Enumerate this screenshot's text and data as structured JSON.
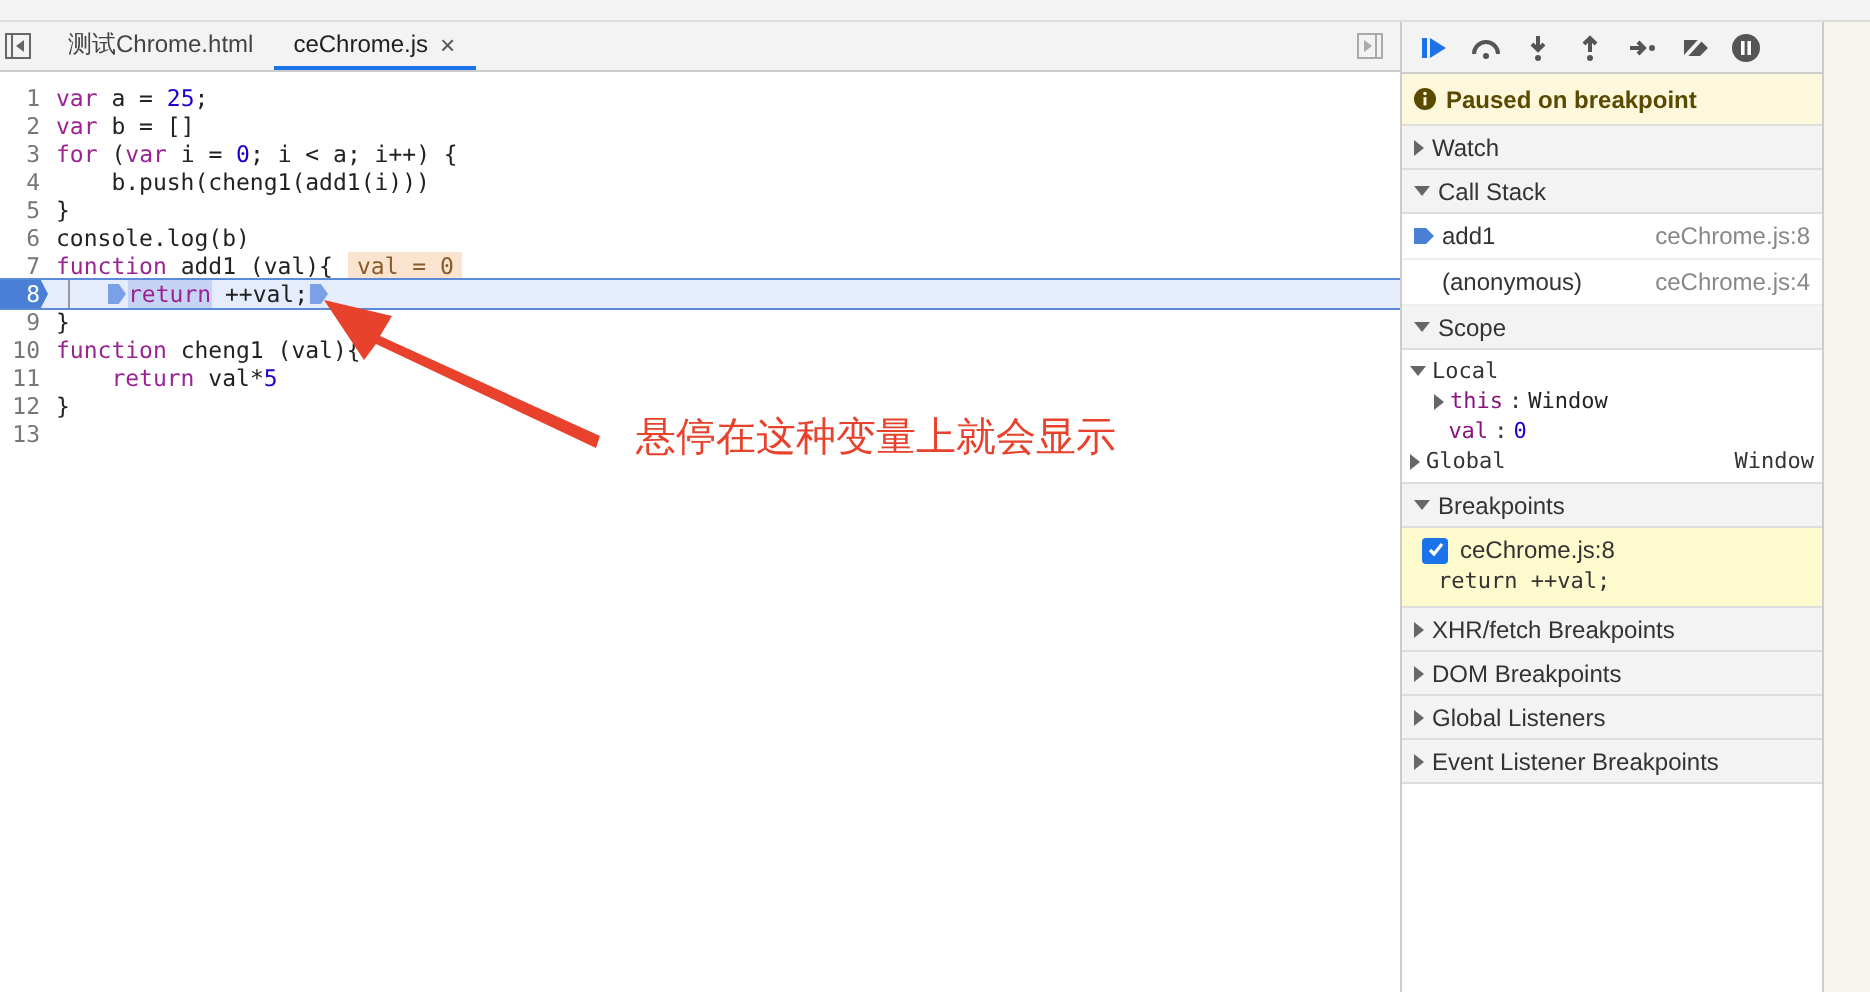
{
  "tabs": [
    {
      "label": "测试Chrome.html",
      "selected": false
    },
    {
      "label": "ceChrome.js",
      "selected": true,
      "close": "×"
    }
  ],
  "code": [
    {
      "number": "1",
      "paused": false,
      "tokens": [
        {
          "text": "var",
          "kind": "keyword"
        },
        {
          "text": " a = ",
          "kind": "plain"
        },
        {
          "text": "25",
          "kind": "number"
        },
        {
          "text": ";",
          "kind": "plain"
        }
      ]
    },
    {
      "number": "2",
      "paused": false,
      "tokens": [
        {
          "text": "var",
          "kind": "keyword"
        },
        {
          "text": " b = []",
          "kind": "plain"
        }
      ]
    },
    {
      "number": "3",
      "paused": false,
      "tokens": [
        {
          "text": "for",
          "kind": "keyword"
        },
        {
          "text": " (",
          "kind": "plain"
        },
        {
          "text": "var",
          "kind": "keyword"
        },
        {
          "text": " i = ",
          "kind": "plain"
        },
        {
          "text": "0",
          "kind": "number"
        },
        {
          "text": "; i < a; i++) {",
          "kind": "plain"
        }
      ]
    },
    {
      "number": "4",
      "paused": false,
      "tokens": [
        {
          "text": "    b.push(cheng1(add1(i)))",
          "kind": "plain"
        }
      ]
    },
    {
      "number": "5",
      "paused": false,
      "tokens": [
        {
          "text": "}",
          "kind": "plain"
        }
      ]
    },
    {
      "number": "6",
      "paused": false,
      "tokens": [
        {
          "text": "console.log(b)",
          "kind": "plain"
        }
      ]
    },
    {
      "number": "7",
      "paused": false,
      "inline_value": "val = 0",
      "tokens": [
        {
          "text": "function",
          "kind": "keyword"
        },
        {
          "text": " add1 (val){",
          "kind": "plain"
        }
      ]
    },
    {
      "number": "8",
      "paused": true,
      "tokens": [
        {
          "text": "return",
          "kind": "hovered"
        },
        {
          "text": " ++val;",
          "kind": "plain"
        }
      ]
    },
    {
      "number": "9",
      "paused": false,
      "tokens": [
        {
          "text": "}",
          "kind": "plain"
        }
      ]
    },
    {
      "number": "10",
      "paused": false,
      "tokens": [
        {
          "text": "function",
          "kind": "keyword"
        },
        {
          "text": " cheng1 (val){",
          "kind": "plain"
        }
      ]
    },
    {
      "number": "11",
      "paused": false,
      "tokens": [
        {
          "text": "    return",
          "kind": "keyword"
        },
        {
          "text": " val*",
          "kind": "plain"
        },
        {
          "text": "5",
          "kind": "number"
        }
      ]
    },
    {
      "number": "12",
      "paused": false,
      "tokens": [
        {
          "text": "}",
          "kind": "plain"
        }
      ]
    },
    {
      "number": "13",
      "paused": false
    }
  ],
  "annotation": "悬停在这种变量上就会显示",
  "paused_banner": "Paused on breakpoint",
  "sections": [
    {
      "title": "Watch",
      "expanded": false
    },
    {
      "kind": "callstack",
      "title": "Call Stack",
      "expanded": true,
      "frames": [
        {
          "name": "add1",
          "location": "ceChrome.js:8",
          "selected": true
        },
        {
          "name": "(anonymous)",
          "location": "ceChrome.js:4",
          "selected": false
        }
      ]
    },
    {
      "kind": "scope",
      "title": "Scope",
      "expanded": true,
      "scopes": [
        {
          "name": "Local",
          "expanded": true,
          "props": [
            {
              "key": "this",
              "sep": ":",
              "value": "Window",
              "expandable": true
            },
            {
              "key": "val",
              "sep": ":",
              "value": "0",
              "expandable": false
            }
          ]
        },
        {
          "name": "Global",
          "expanded": false,
          "value": "Window"
        }
      ]
    },
    {
      "kind": "breakpoints",
      "title": "Breakpoints",
      "expanded": true,
      "items": [
        {
          "file": "ceChrome.js:8",
          "code": "return ++val;",
          "checked": true
        }
      ]
    },
    {
      "title": "XHR/fetch Breakpoints",
      "expanded": false
    },
    {
      "title": "DOM Breakpoints",
      "expanded": false
    },
    {
      "title": "Global Listeners",
      "expanded": false
    },
    {
      "title": "Event Listener Breakpoints",
      "expanded": false
    }
  ]
}
